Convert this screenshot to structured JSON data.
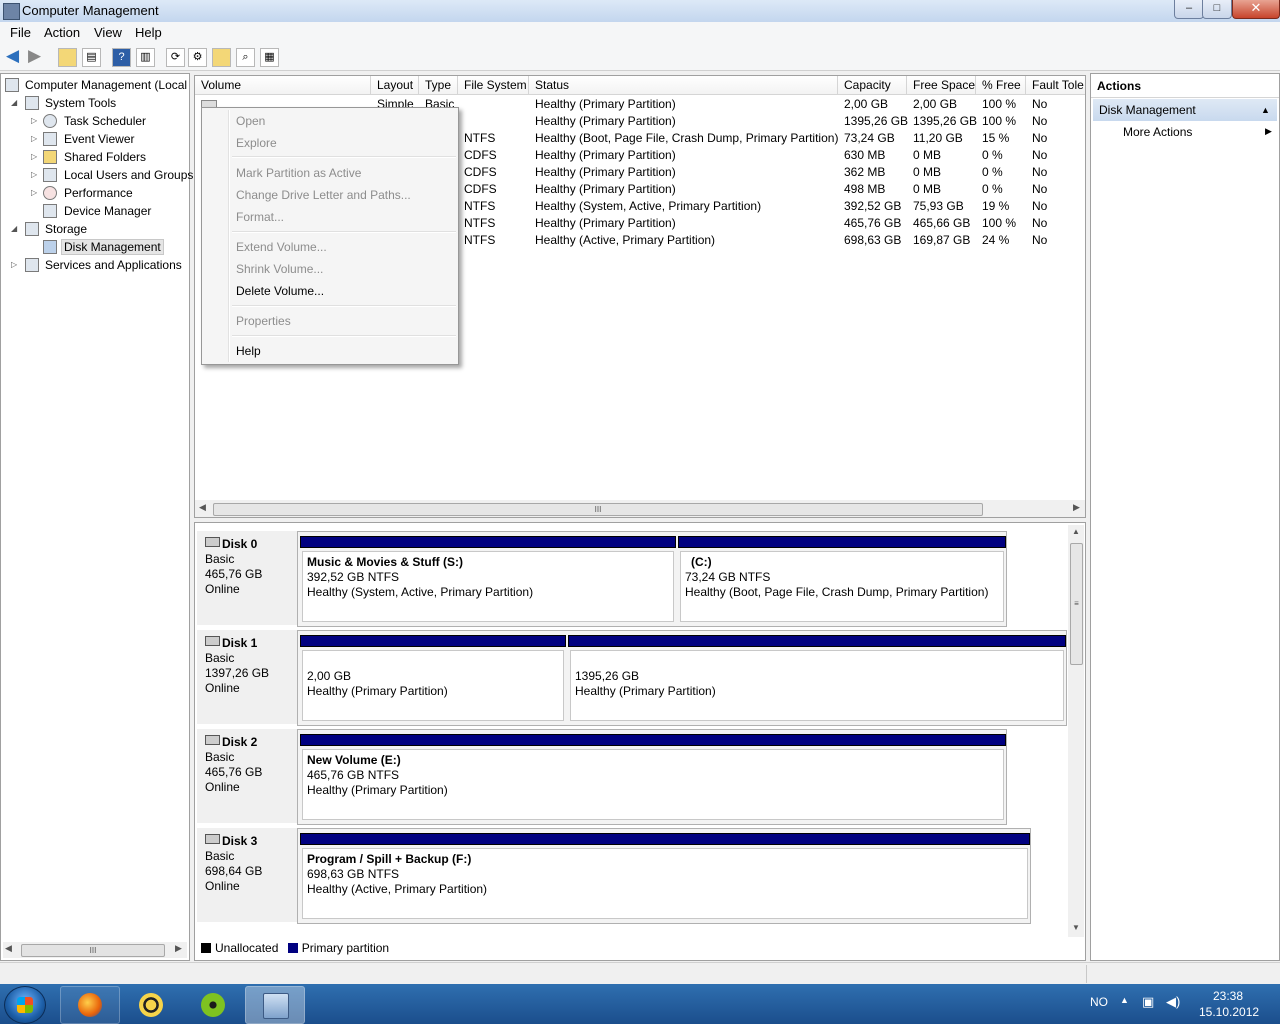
{
  "window": {
    "title": "Computer Management",
    "minimize": "–",
    "maximize": "□",
    "close": "✕"
  },
  "menubar": {
    "file": "File",
    "action": "Action",
    "view": "View",
    "help": "Help"
  },
  "tree": {
    "root": "Computer Management (Local",
    "system_tools": "System Tools",
    "task_scheduler": "Task Scheduler",
    "event_viewer": "Event Viewer",
    "shared_folders": "Shared Folders",
    "local_users": "Local Users and Groups",
    "performance": "Performance",
    "device_manager": "Device Manager",
    "storage": "Storage",
    "disk_management": "Disk Management",
    "services": "Services and Applications"
  },
  "volume_list": {
    "columns": [
      "Volume",
      "Layout",
      "Type",
      "File System",
      "Status",
      "Capacity",
      "Free Space",
      "% Free",
      "Fault Tole"
    ],
    "first_row": {
      "layout": "Simple",
      "type": "Basic"
    },
    "rows": [
      {
        "fs": "",
        "status": "Healthy (Primary Partition)",
        "capacity": "2,00 GB",
        "free": "2,00 GB",
        "pct": "100 %",
        "fault": "No"
      },
      {
        "fs": "",
        "status": "Healthy (Primary Partition)",
        "capacity": "1395,26 GB",
        "free": "1395,26 GB",
        "pct": "100 %",
        "fault": "No"
      },
      {
        "fs": "NTFS",
        "status": "Healthy (Boot, Page File, Crash Dump, Primary Partition)",
        "capacity": "73,24 GB",
        "free": "11,20 GB",
        "pct": "15 %",
        "fault": "No"
      },
      {
        "fs": "CDFS",
        "status": "Healthy (Primary Partition)",
        "capacity": "630 MB",
        "free": "0 MB",
        "pct": "0 %",
        "fault": "No"
      },
      {
        "fs": "CDFS",
        "status": "Healthy (Primary Partition)",
        "capacity": "362 MB",
        "free": "0 MB",
        "pct": "0 %",
        "fault": "No"
      },
      {
        "fs": "CDFS",
        "status": "Healthy (Primary Partition)",
        "capacity": "498 MB",
        "free": "0 MB",
        "pct": "0 %",
        "fault": "No"
      },
      {
        "fs": "NTFS",
        "status": "Healthy (System, Active, Primary Partition)",
        "capacity": "392,52 GB",
        "free": "75,93 GB",
        "pct": "19 %",
        "fault": "No"
      },
      {
        "fs": "NTFS",
        "status": "Healthy (Primary Partition)",
        "capacity": "465,76 GB",
        "free": "465,66 GB",
        "pct": "100 %",
        "fault": "No"
      },
      {
        "fs": "NTFS",
        "status": "Healthy (Active, Primary Partition)",
        "capacity": "698,63 GB",
        "free": "169,87 GB",
        "pct": "24 %",
        "fault": "No"
      }
    ]
  },
  "context_menu": {
    "open": "Open",
    "explore": "Explore",
    "mark_active": "Mark Partition as Active",
    "change_letter": "Change Drive Letter and Paths...",
    "format": "Format...",
    "extend": "Extend Volume...",
    "shrink": "Shrink Volume...",
    "delete": "Delete Volume...",
    "properties": "Properties",
    "help": "Help"
  },
  "disks": [
    {
      "name": "Disk 0",
      "type": "Basic",
      "size": "465,76 GB",
      "state": "Online",
      "partitions": [
        {
          "name": "Music & Movies & Stuff  (S:)",
          "size": "392,52 GB NTFS",
          "status": "Healthy (System, Active, Primary Partition)"
        },
        {
          "name": "(C:)",
          "size": "73,24 GB NTFS",
          "status": "Healthy (Boot, Page File, Crash Dump, Primary Partition)"
        }
      ]
    },
    {
      "name": "Disk 1",
      "type": "Basic",
      "size": "1397,26 GB",
      "state": "Online",
      "partitions": [
        {
          "name": "",
          "size": "2,00 GB",
          "status": "Healthy (Primary Partition)"
        },
        {
          "name": "",
          "size": "1395,26 GB",
          "status": "Healthy (Primary Partition)"
        }
      ]
    },
    {
      "name": "Disk 2",
      "type": "Basic",
      "size": "465,76 GB",
      "state": "Online",
      "partitions": [
        {
          "name": "New Volume  (E:)",
          "size": "465,76 GB NTFS",
          "status": "Healthy (Primary Partition)"
        }
      ]
    },
    {
      "name": "Disk 3",
      "type": "Basic",
      "size": "698,64 GB",
      "state": "Online",
      "partitions": [
        {
          "name": "Program / Spill + Backup  (F:)",
          "size": "698,63 GB NTFS",
          "status": "Healthy (Active, Primary Partition)"
        }
      ]
    }
  ],
  "legend": {
    "unallocated": "Unallocated",
    "primary": "Primary partition",
    "unallocated_color": "#000000",
    "primary_color": "#000080"
  },
  "actions": {
    "title": "Actions",
    "section": "Disk Management",
    "more": "More Actions"
  },
  "tray": {
    "lang": "NO",
    "time": "23:38",
    "date": "15.10.2012"
  },
  "scroll_glyph": "III"
}
